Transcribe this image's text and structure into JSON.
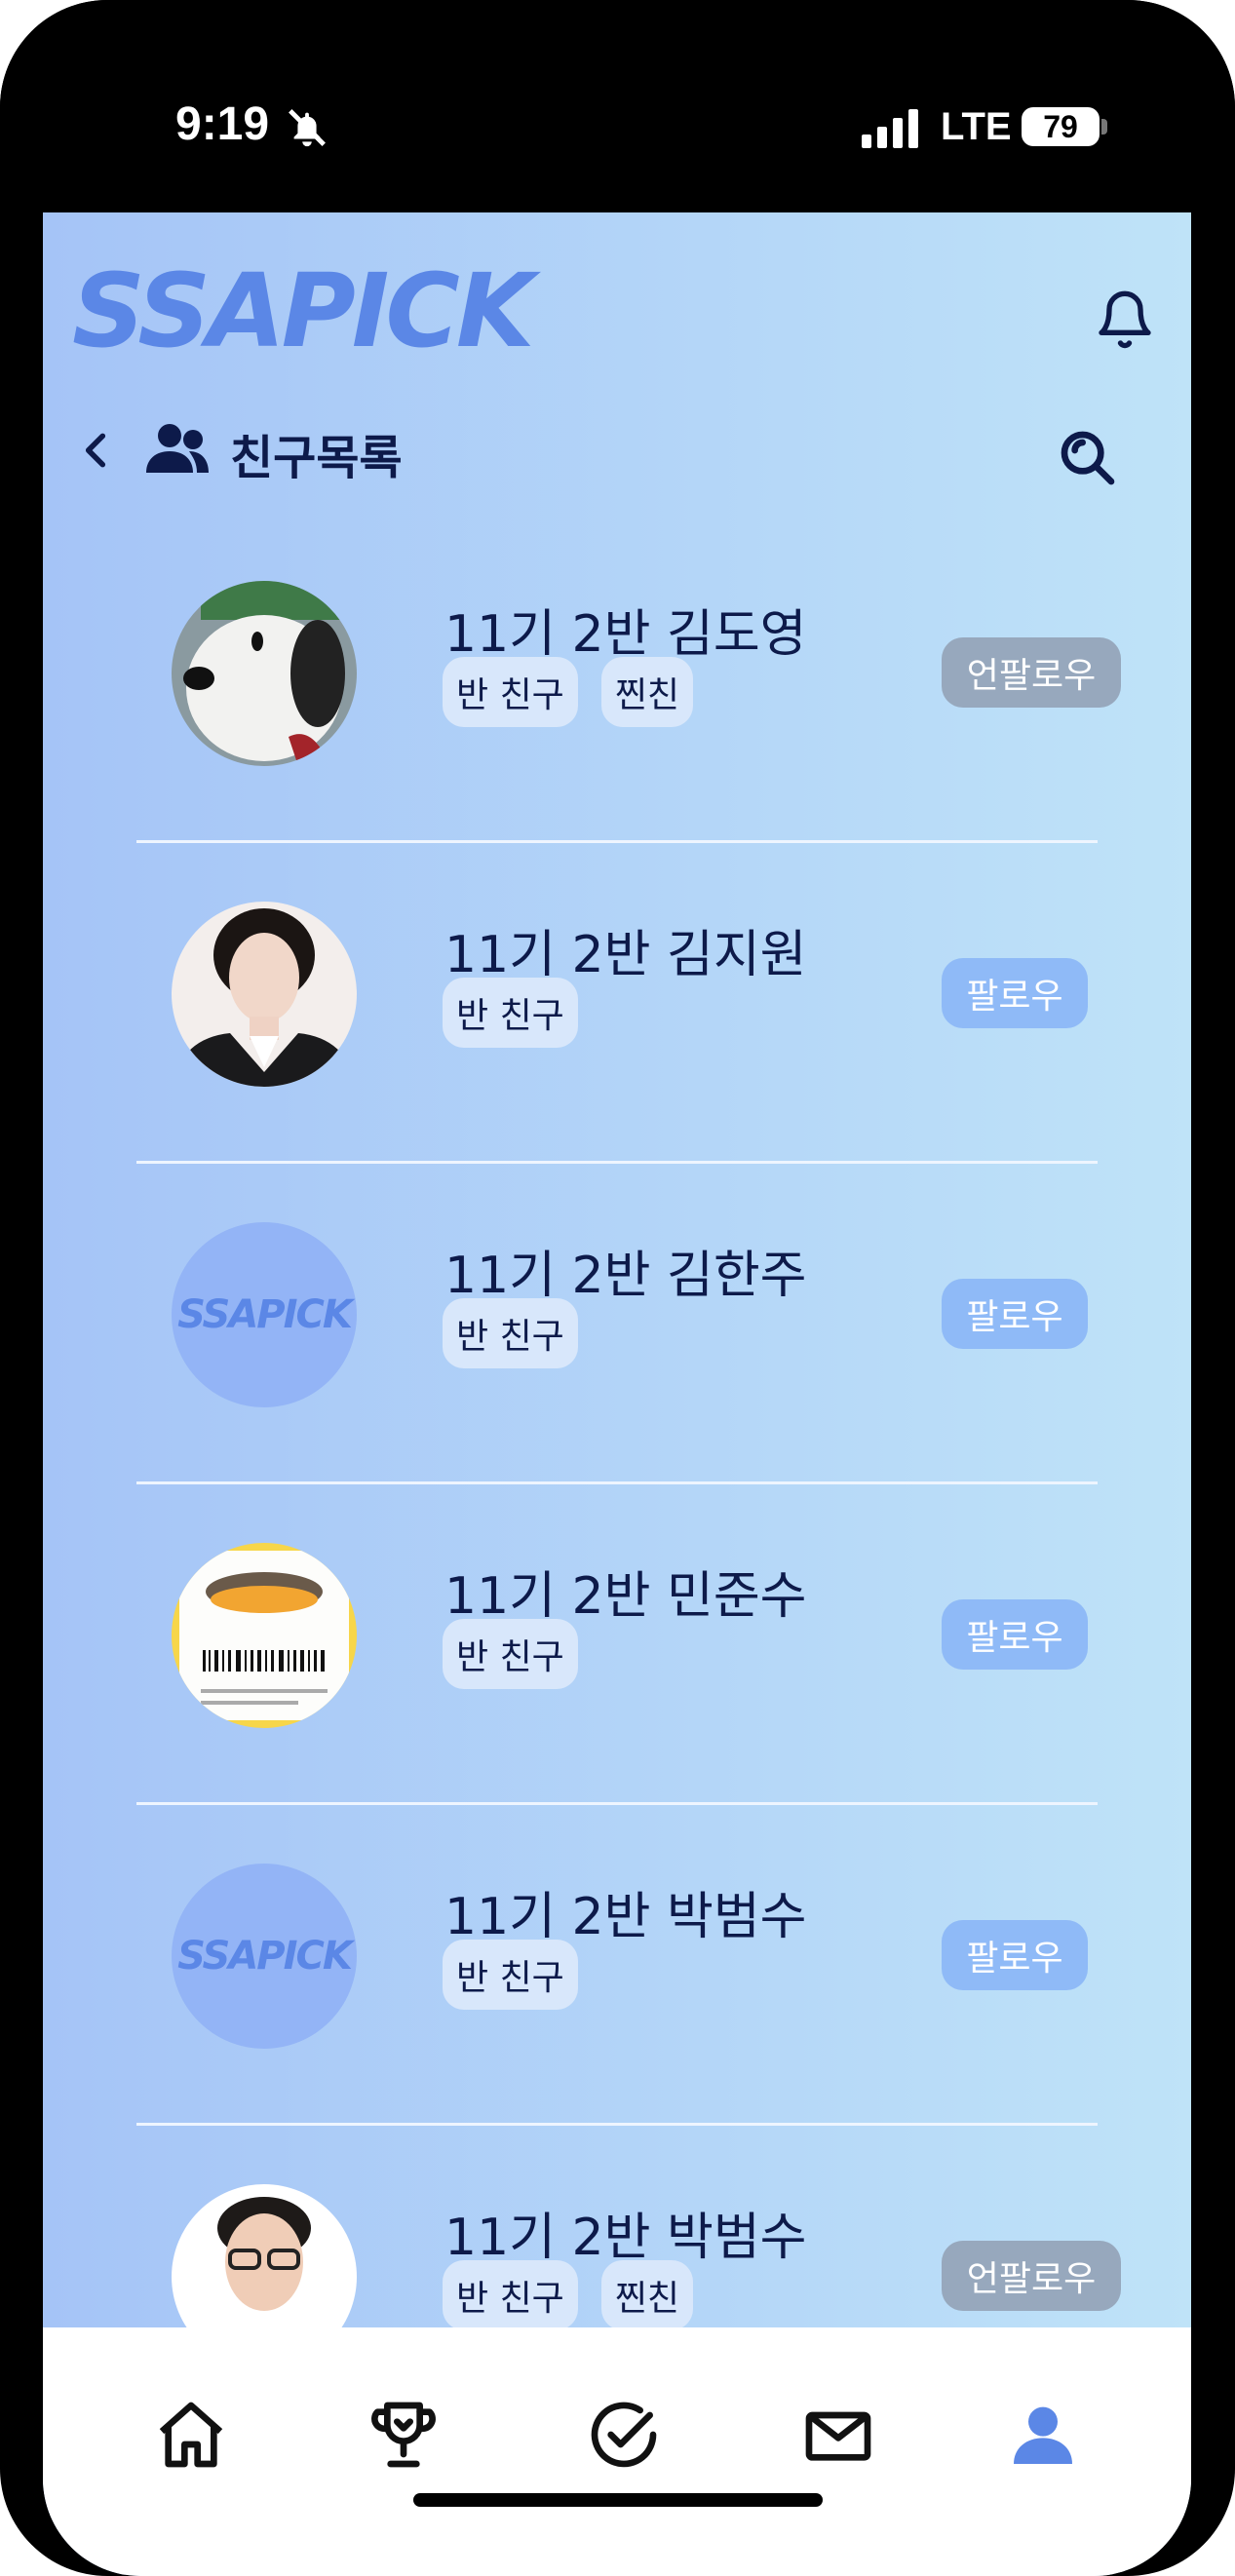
{
  "status_bar": {
    "time": "9:19",
    "network": "LTE",
    "battery": "79"
  },
  "header": {
    "logo": "SSAPICK",
    "title": "친구목록"
  },
  "friends": [
    {
      "name": "11기 2반 김도영",
      "tags": [
        "반 친구",
        "찐친"
      ],
      "action": "언팔로우",
      "avatar": "snoopy-photo"
    },
    {
      "name": "11기 2반 김지원",
      "tags": [
        "반 친구"
      ],
      "action": "팔로우",
      "avatar": "portrait-photo"
    },
    {
      "name": "11기 2반 김한주",
      "tags": [
        "반 친구"
      ],
      "action": "팔로우",
      "avatar": "ssapick-default"
    },
    {
      "name": "11기 2반 민준수",
      "tags": [
        "반 친구"
      ],
      "action": "팔로우",
      "avatar": "receipt-photo"
    },
    {
      "name": "11기 2반 박범수",
      "tags": [
        "반 친구"
      ],
      "action": "팔로우",
      "avatar": "ssapick-default"
    },
    {
      "name": "11기 2반 박범수",
      "tags": [
        "반 친구",
        "찐친"
      ],
      "action": "언팔로우",
      "avatar": "portrait-photo"
    }
  ],
  "avatar_logo_text": "SSAPICK",
  "bottom_nav": [
    "home-icon",
    "trophy-icon",
    "check-icon",
    "mail-icon",
    "profile-icon"
  ],
  "colors": {
    "accent": "#5b87e6",
    "follow": "#8fbaf7",
    "unfollow": "#97a8bd",
    "text": "#0d1a4a"
  }
}
